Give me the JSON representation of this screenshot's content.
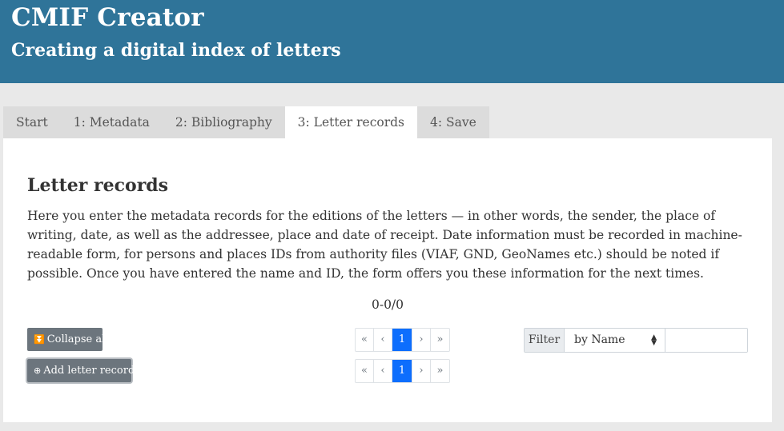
{
  "header": {
    "title": "CMIF Creator",
    "subtitle": "Creating a digital index of letters"
  },
  "tabs": [
    {
      "label": "Start",
      "active": false
    },
    {
      "label": "1: Metadata",
      "active": false
    },
    {
      "label": "2: Bibliography",
      "active": false
    },
    {
      "label": "3: Letter records",
      "active": true
    },
    {
      "label": "4: Save",
      "active": false
    }
  ],
  "section": {
    "heading": "Letter records",
    "description": "Here you enter the metadata records for the editions of the letters — in other words, the sender, the place of writing, date, as well as the addressee, place and date of receipt. Date information must be recorded in machine-readable form, for persons and places IDs from authority files (VIAF, GND, GeoNames etc.) should be noted if possible. Once you have entered the name and ID, the form offers you these information for the next times.",
    "counter": "0-0/0"
  },
  "buttons": {
    "collapse_all": "Collapse all",
    "add_letter_record": "Add letter record"
  },
  "pagination": {
    "first": "«",
    "prev": "‹",
    "current": "1",
    "next": "›",
    "last": "»"
  },
  "filter": {
    "label": "Filter",
    "selected": "by Name",
    "value": ""
  },
  "colors": {
    "header_bg": "#2f7499",
    "button_bg": "#6c757d",
    "page_active": "#0d6efd"
  }
}
